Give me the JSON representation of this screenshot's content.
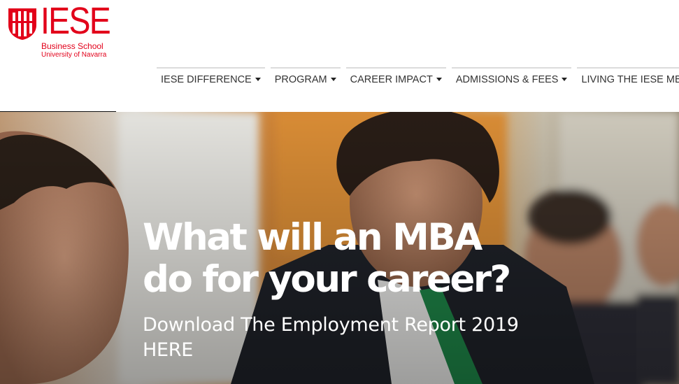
{
  "logo": {
    "wordmark": "IESE",
    "line1": "Business School",
    "line2": "University of Navarra",
    "brand_color": "#e2001a"
  },
  "nav": {
    "items": [
      {
        "label": "IESE DIFFERENCE"
      },
      {
        "label": "PROGRAM"
      },
      {
        "label": "CAREER IMPACT"
      },
      {
        "label": "ADMISSIONS & FEES"
      },
      {
        "label": "LIVING THE IESE MBA"
      }
    ]
  },
  "hero": {
    "title_line1": "What will an MBA",
    "title_line2": "do for your career?",
    "cta_line1": "Download The Employment Report 2019",
    "cta_line2": "HERE"
  }
}
